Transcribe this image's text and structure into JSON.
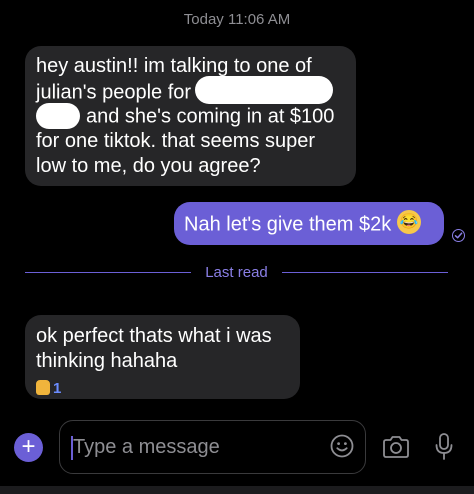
{
  "header": {
    "timestamp": "Today 11:06 AM"
  },
  "messages": {
    "incoming_1": {
      "lines": [
        "hey austin!! im talking to one of",
        "julian's people for",
        "and she's coming in at $100",
        "for one tiktok. that seems super",
        "low to me, do you agree?"
      ]
    },
    "outgoing_1": {
      "text": "Nah let's give them $2k",
      "emoji": "laughing-tears-emoji"
    },
    "divider": {
      "label": "Last read"
    },
    "incoming_2": {
      "lines": [
        "ok perfect thats what i was",
        "thinking hahaha"
      ],
      "reaction": {
        "icon": "thumbs-up-emoji",
        "count": "1"
      }
    }
  },
  "composer": {
    "placeholder": "Type a message",
    "plus_icon": "plus-icon",
    "emoji_icon": "smiley-icon",
    "camera_icon": "camera-icon",
    "mic_icon": "microphone-icon"
  },
  "colors": {
    "background": "#000000",
    "incoming_bubble": "#262628",
    "outgoing_bubble": "#6b5fd6",
    "accent": "#8a7fe6",
    "muted_text": "#8e8e93"
  }
}
